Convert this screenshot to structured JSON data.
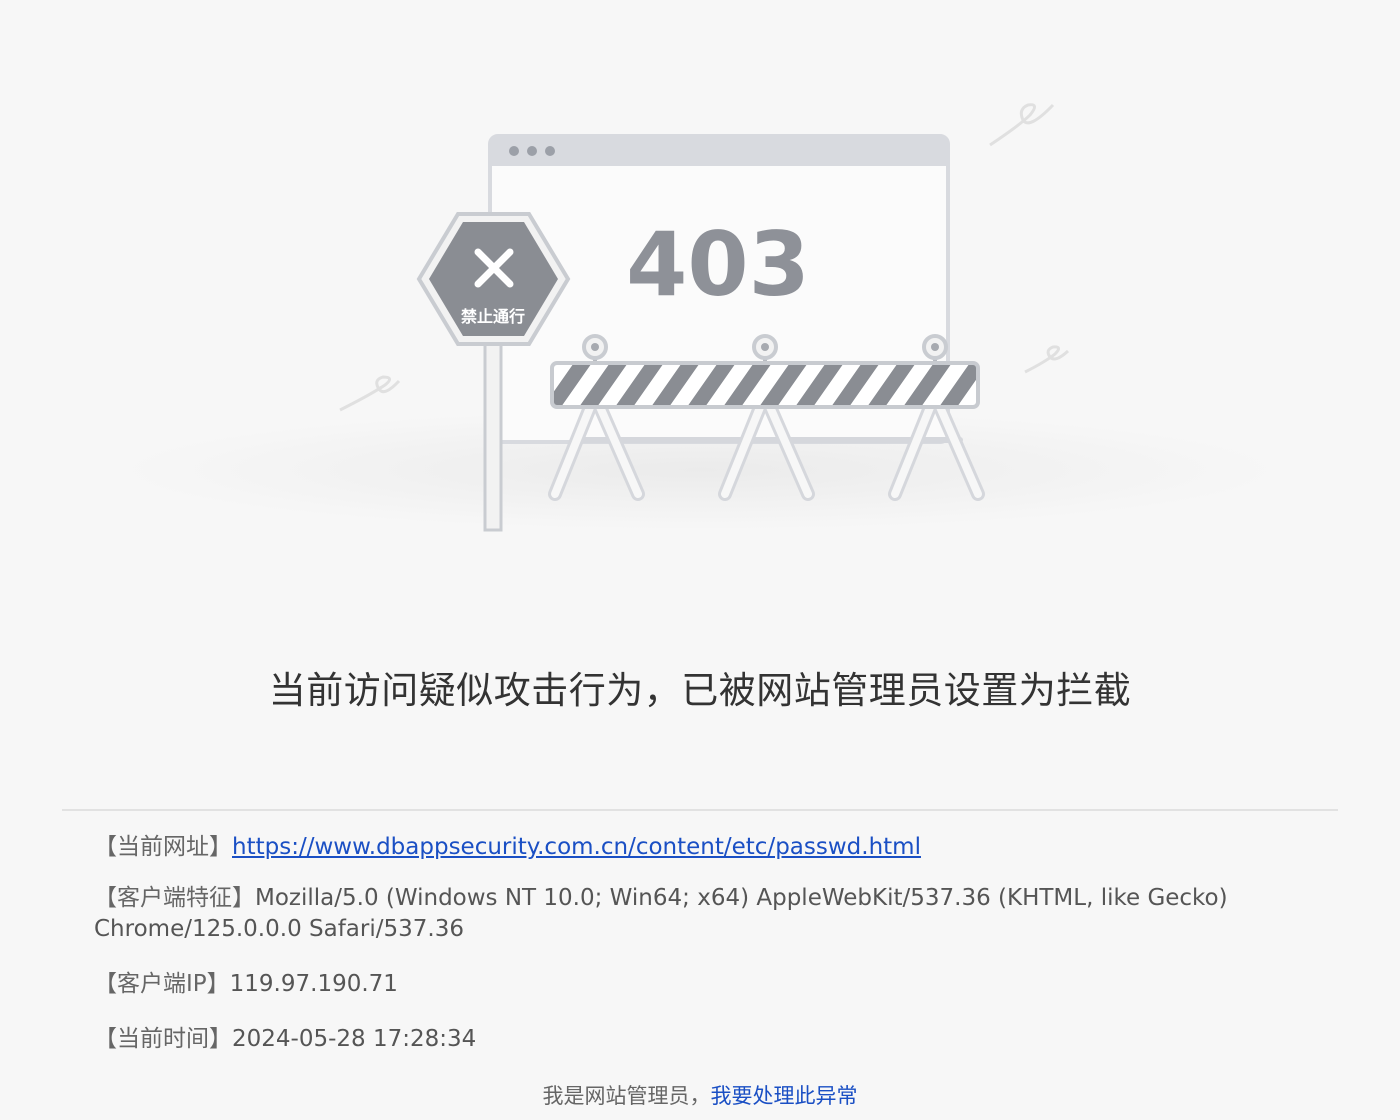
{
  "illustration": {
    "error_code": "403",
    "sign_text": "禁止通行",
    "sign_icon": "close-icon"
  },
  "message": "当前访问疑似攻击行为，已被网站管理员设置为拦截",
  "info": {
    "url_label": "【当前网址】",
    "url_value": "https://www.dbappsecurity.com.cn/content/etc/passwd.html",
    "ua_label": "【客户端特征】",
    "ua_value_line1": "Mozilla/5.0 (Windows NT 10.0; Win64; x64) AppleWebKit/537.36 (KHTML, like Gecko)",
    "ua_value_line2": "Chrome/125.0.0.0 Safari/537.36",
    "ip_label": "【客户端IP】",
    "ip_value": "119.97.190.71",
    "time_label": "【当前时间】",
    "time_value": "2024-05-28 17:28:34"
  },
  "footer": {
    "text": "我是网站管理员，",
    "link": "我要处理此异常"
  },
  "colors": {
    "background": "#f7f7f7",
    "link": "#1a4fc4",
    "text": "#555555",
    "heading": "#333333"
  }
}
